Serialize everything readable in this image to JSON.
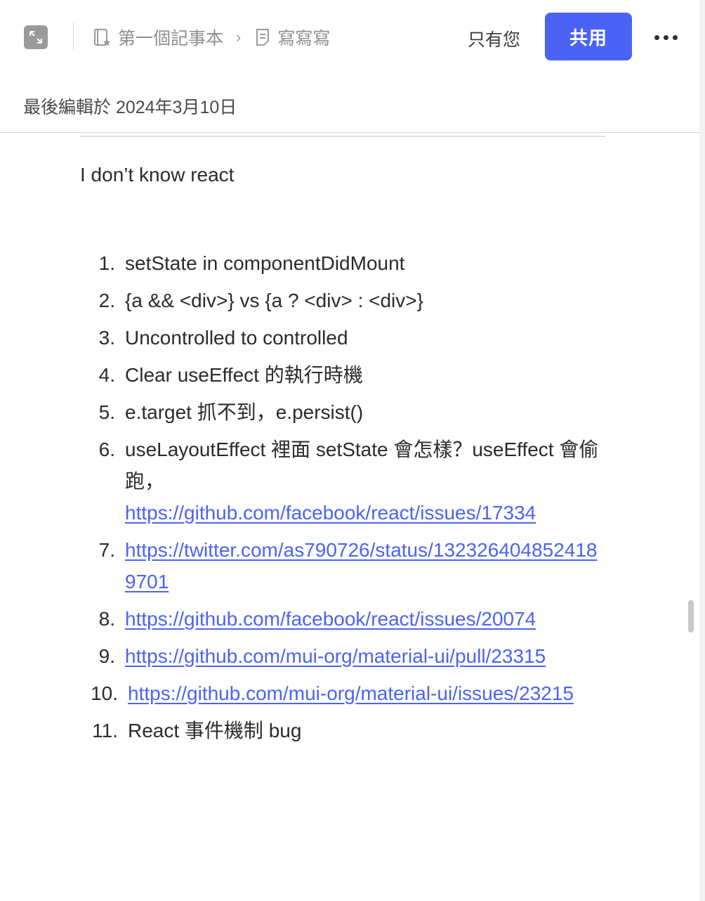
{
  "header": {
    "breadcrumb": [
      {
        "label": "第一個記事本",
        "icon": "notebook-star-icon"
      },
      {
        "label": "寫寫寫",
        "icon": "note-icon"
      }
    ],
    "separator": "›",
    "owner_text": "只有您",
    "share_label": "共用",
    "accent_color": "#4a63f5"
  },
  "meta": {
    "last_edited": "最後編輯於 2024年3月10日"
  },
  "note": {
    "intro": "I don’t know react",
    "items": [
      {
        "num": "1.",
        "text": "setState in componentDidMount"
      },
      {
        "num": "2.",
        "text": "{a && <div>} vs {a ? <div> : <div>}"
      },
      {
        "num": "3.",
        "text": "Uncontrolled to controlled"
      },
      {
        "num": "4.",
        "text": "Clear useEffect 的執行時機"
      },
      {
        "num": "5.",
        "text": "e.target 抓不到，e.persist()"
      },
      {
        "num": "6.",
        "text": "useLayoutEffect 裡面 setState 會怎樣？useEffect 會偷跑，",
        "link": "https://github.com/facebook/react/issues/17334"
      },
      {
        "num": "7.",
        "link": "https://twitter.com/as790726/status/1323264048524189701"
      },
      {
        "num": "8.",
        "link": "https://github.com/facebook/react/issues/20074"
      },
      {
        "num": "9.",
        "link": "https://github.com/mui-org/material-ui/pull/23315"
      },
      {
        "num": "10.",
        "link": "https://github.com/mui-org/material-ui/issues/23215"
      },
      {
        "num": "11.",
        "text": "React 事件機制 bug"
      }
    ]
  }
}
